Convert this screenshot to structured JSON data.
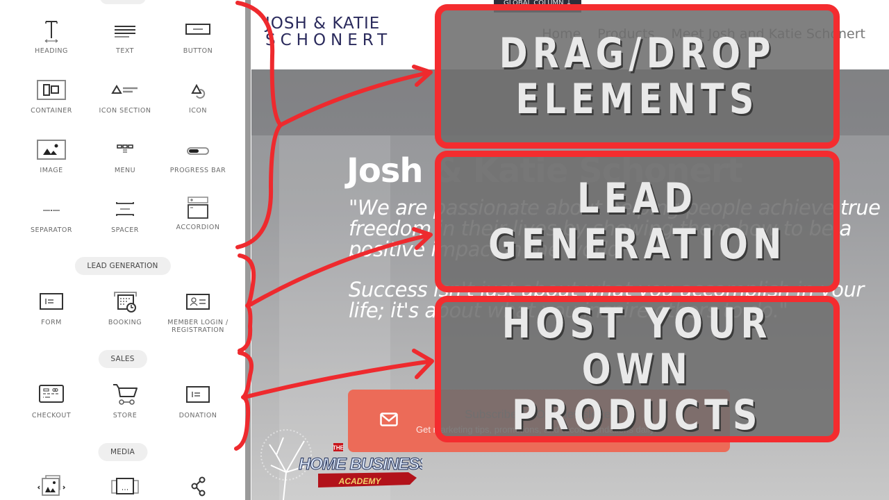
{
  "panel": {
    "top_category": "",
    "basic_elements": [
      {
        "label": "HEADING",
        "icon": "heading-icon"
      },
      {
        "label": "TEXT",
        "icon": "text-icon"
      },
      {
        "label": "BUTTON",
        "icon": "button-icon"
      },
      {
        "label": "CONTAINER",
        "icon": "container-icon"
      },
      {
        "label": "ICON SECTION",
        "icon": "icon-section-icon"
      },
      {
        "label": "ICON",
        "icon": "icon-icon"
      },
      {
        "label": "IMAGE",
        "icon": "image-icon"
      },
      {
        "label": "MENU",
        "icon": "menu-icon"
      },
      {
        "label": "PROGRESS BAR",
        "icon": "progress-bar-icon"
      },
      {
        "label": "SEPARATOR",
        "icon": "separator-icon"
      },
      {
        "label": "SPACER",
        "icon": "spacer-icon"
      },
      {
        "label": "ACCORDION",
        "icon": "accordion-icon"
      }
    ],
    "lead_generation": {
      "category": "LEAD GENERATION",
      "items": [
        {
          "label": "FORM",
          "icon": "form-icon"
        },
        {
          "label": "BOOKING",
          "icon": "booking-icon"
        },
        {
          "label": "MEMBER LOGIN / REGISTRATION",
          "icon": "member-login-icon"
        }
      ]
    },
    "sales": {
      "category": "SALES",
      "items": [
        {
          "label": "CHECKOUT",
          "icon": "checkout-icon"
        },
        {
          "label": "STORE",
          "icon": "cart-icon"
        },
        {
          "label": "DONATION",
          "icon": "donation-icon"
        }
      ]
    },
    "media": {
      "category": "MEDIA",
      "items": [
        {
          "label": "",
          "icon": "gallery-slider-icon"
        },
        {
          "label": "",
          "icon": "carousel-icon"
        },
        {
          "label": "",
          "icon": "share-icon"
        }
      ]
    }
  },
  "preview": {
    "logo_line1": "JOSH & KATIE",
    "logo_line2": "SCHONERT",
    "global_column_label": "GLOBAL COLUMN ↓",
    "nav": [
      "Home",
      "Products",
      "Meet Josh and Katie Schonert"
    ],
    "hero_title_visible": "Josh",
    "hero_title_rest": " & Katie Schonert",
    "quote_p1": "\"We are passionate about helping people achieve true freedom in their lives by showing them how to be a positive impact in the world!",
    "quote_p2": "Success isn't just about what you accomplish in your life; it's about what you inspire others to do.\"",
    "newsletter_title": "Subscribe To Our Newsletter!",
    "newsletter_sub": "Get marketing tips, promotions, and recommendations daily!",
    "brand_logo": {
      "top": "THE",
      "main": "HOME BUSINESS",
      "ribbon": "ACADEMY"
    }
  },
  "callouts": [
    {
      "line1": "DRAG/DROP",
      "line2": "ELEMENTS"
    },
    {
      "line1": "LEAD",
      "line2": "GENERATION"
    },
    {
      "line1": "HOST YOUR",
      "line2": "OWN PRODUCTS"
    }
  ],
  "colors": {
    "callout_border": "#f42c2f",
    "annotation_red": "#ee2a2e",
    "newsletter_bg": "#ec6b58",
    "logo_navy": "#2a2a5c"
  }
}
